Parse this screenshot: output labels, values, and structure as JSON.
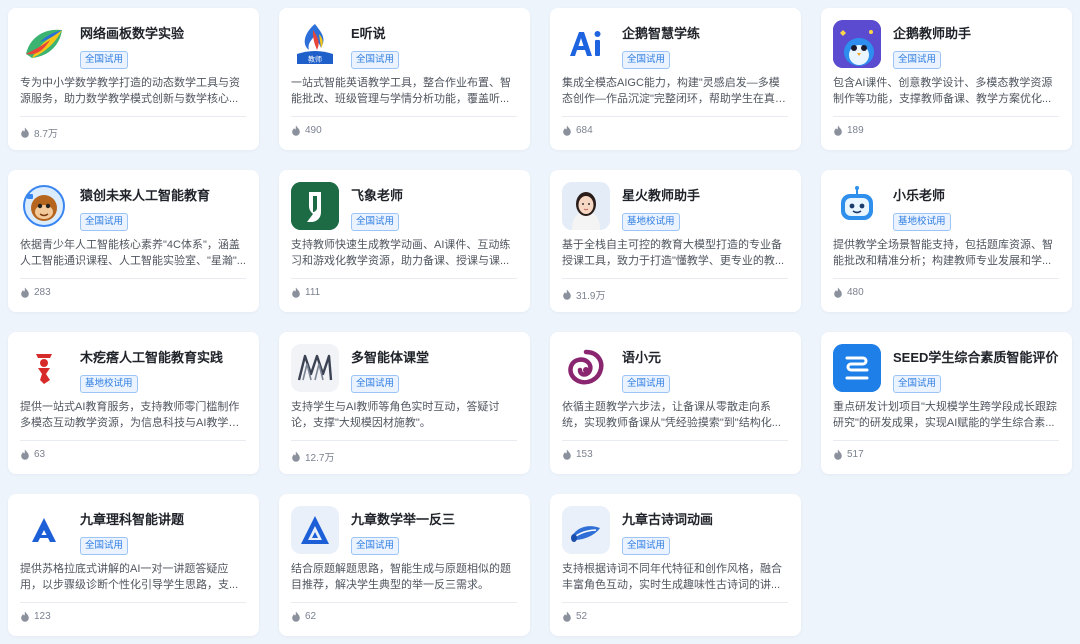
{
  "cards": [
    {
      "title": "网络画板数学实验",
      "badge": "全国试用",
      "desc": "专为中小学数学教学打造的动态数学工具与资源服务，助力数学教学模式创新与数学核心...",
      "count": "8.7万",
      "icon": "rainbow-leaf-icon"
    },
    {
      "title": "E听说",
      "badge": "全国试用",
      "desc": "一站式智能英语教学工具，整合作业布置、智能批改、班级管理与学情分析功能，覆盖听...",
      "count": "490",
      "icon": "teacher-flame-icon",
      "icon_label": "教师"
    },
    {
      "title": "企鹅智慧学练",
      "badge": "全国试用",
      "desc": "集成全模态AIGC能力，构建\"灵感启发—多模态创作—作品沉淀\"完整闭环，帮助学生在真实...",
      "count": "684",
      "icon": "ai-letters-icon"
    },
    {
      "title": "企鹅教师助手",
      "badge": "全国试用",
      "desc": "包含AI课件、创意教学设计、多模态教学资源制作等功能，支撑教师备课、教学方案优化...",
      "count": "189",
      "icon": "penguin-mascot-icon"
    },
    {
      "title": "猿创未来人工智能教育",
      "badge": "全国试用",
      "desc": "依据青少年人工智能核心素养\"4C体系\"，涵盖人工智能通识课程、人工智能实验室、\"星瀚\"...",
      "count": "283",
      "icon": "monkey-astronaut-icon"
    },
    {
      "title": "飞象老师",
      "badge": "全国试用",
      "desc": "支持教师快速生成教学动画、AI课件、互动练习和游戏化教学资源，助力备课、授课与课...",
      "count": "111",
      "icon": "green-leaf-icon"
    },
    {
      "title": "星火教师助手",
      "badge": "基地校试用",
      "desc": "基于全栈自主可控的教育大模型打造的专业备授课工具，致力于打造\"懂教学、更专业的教...",
      "count": "31.9万",
      "icon": "teacher-avatar-icon"
    },
    {
      "title": "小乐老师",
      "badge": "基地校试用",
      "desc": "提供教学全场景智能支持，包括题库资源、智能批改和精准分析；构建教师专业发展和学...",
      "count": "480",
      "icon": "robot-face-icon"
    },
    {
      "title": "木疙瘩人工智能教育实践",
      "badge": "基地校试用",
      "desc": "提供一站式AI教育服务，支持教师零门槛制作多模态互动教学资源，为信息科技与AI教学提...",
      "count": "63",
      "icon": "red-figure-icon"
    },
    {
      "title": "多智能体课堂",
      "badge": "全国试用",
      "desc": "支持学生与AI教师等角色实时互动，答疑讨论，支撑\"大规模因材施教\"。",
      "count": "12.7万",
      "icon": "double-m-icon"
    },
    {
      "title": "语小元",
      "badge": "全国试用",
      "desc": "依循主题教学六步法，让备课从零散走向系统，实现教师备课从\"凭经验摸索\"到\"结构化...",
      "count": "153",
      "icon": "purple-swirl-icon"
    },
    {
      "title": "SEED学生综合素质智能评价",
      "badge": "全国试用",
      "desc": "重点研发计划项目\"大规模学生跨学段成长跟踪研究\"的研发成果，实现AI赋能的学生综合素...",
      "count": "517",
      "icon": "seed-square-icon"
    },
    {
      "title": "九章理科智能讲题",
      "badge": "全国试用",
      "desc": "提供苏格拉底式讲解的AI一对一讲题答疑应用，以步骤级诊断个性化引导学生思路，支...",
      "count": "123",
      "icon": "blue-a-icon"
    },
    {
      "title": "九章数学举一反三",
      "badge": "全国试用",
      "desc": "结合原题解题思路，智能生成与原题相似的题目推荐，解决学生典型的举一反三需求。",
      "count": "62",
      "icon": "triangle-a-icon"
    },
    {
      "title": "九章古诗词动画",
      "badge": "全国试用",
      "desc": "支持根据诗词不同年代特征和创作风格，融合丰富角色互动，实时生成趣味性古诗词的讲...",
      "count": "52",
      "icon": "scroll-icon"
    }
  ]
}
